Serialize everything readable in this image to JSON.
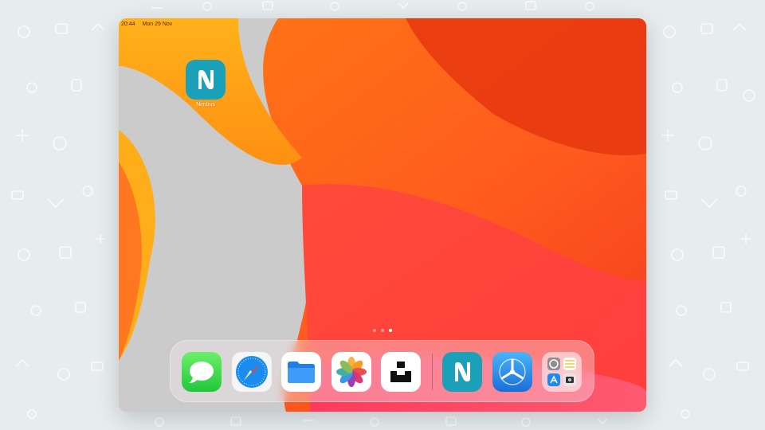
{
  "status_bar": {
    "time": "20:44",
    "date": "Mon 29 Nov"
  },
  "home_screen": {
    "apps": [
      {
        "label": "Nimbus",
        "icon": "nimbus-icon"
      }
    ],
    "page_dots": {
      "count": 3,
      "active_index": 2
    }
  },
  "dock": {
    "apps": [
      {
        "name": "Messages",
        "icon": "messages-icon"
      },
      {
        "name": "Safari",
        "icon": "safari-icon"
      },
      {
        "name": "Files",
        "icon": "files-icon"
      },
      {
        "name": "Photos",
        "icon": "photos-icon"
      },
      {
        "name": "Unsplash",
        "icon": "unsplash-icon"
      },
      {
        "name": "Nimbus",
        "icon": "nimbus-icon"
      },
      {
        "name": "TestFlight",
        "icon": "testflight-icon"
      },
      {
        "name": "App Library",
        "icon": "app-library-icon"
      }
    ]
  },
  "colors": {
    "background": "#e7ecef",
    "nimbus_teal": "#1aa0b8",
    "wallpaper_orange": "#ff6a1a",
    "wallpaper_grey": "#cbcbcb"
  }
}
